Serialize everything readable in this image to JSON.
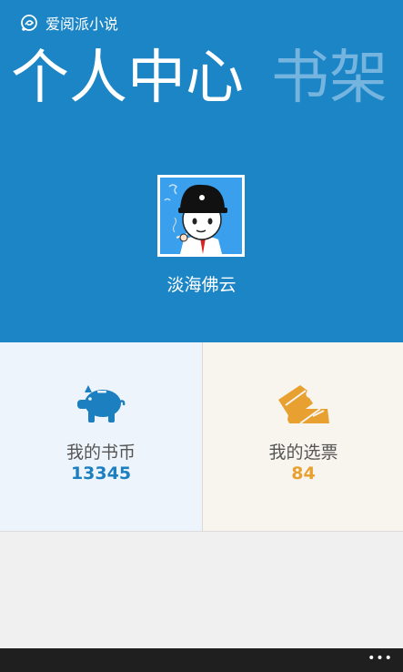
{
  "app": {
    "title": "爱阅派小说",
    "logo_icon": "app-logo-icon"
  },
  "pivot": {
    "active": "个人中心",
    "inactive": "书架"
  },
  "profile": {
    "username": "淡海佛云",
    "avatar_icon": "avatar-cartoon-icon"
  },
  "tiles": {
    "coins": {
      "label": "我的书币",
      "value": "13345",
      "icon": "piggy-bank-icon",
      "color": "#1b7fc0"
    },
    "votes": {
      "label": "我的选票",
      "value": "84",
      "icon": "ticket-icon",
      "color": "#e8a031"
    }
  },
  "appbar": {
    "more": "•••"
  },
  "colors": {
    "accent": "#1b85c6",
    "pivot_inactive": "#75b4df"
  }
}
